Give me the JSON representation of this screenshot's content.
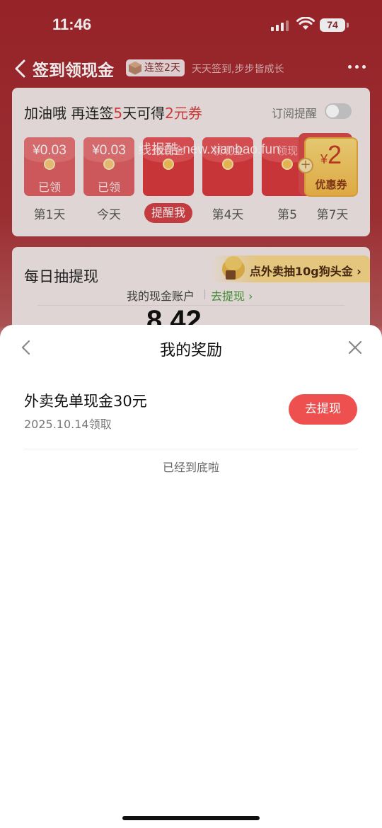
{
  "status_bar": {
    "time": "11:46",
    "battery": "74"
  },
  "nav": {
    "title": "签到领现金",
    "streak_badge": "连签2天",
    "slogan": "天天签到,步步皆成长"
  },
  "signin_card": {
    "headline_prefix": "加油哦  再连签",
    "headline_days": "5",
    "headline_mid": "天可得",
    "headline_reward": "2元券",
    "subscribe_label": "订阅提醒",
    "days": [
      {
        "amount": "¥0.03",
        "status": "已领",
        "label": "第1天"
      },
      {
        "amount": "¥0.03",
        "status": "已领",
        "label": "今天"
      },
      {
        "amount": "领现金",
        "status": "",
        "label": "提醒我"
      },
      {
        "amount": "领现金",
        "status": "",
        "label": "第4天"
      },
      {
        "amount": "领现",
        "status": "",
        "label": "第5"
      }
    ],
    "coupon": {
      "currency": "¥",
      "value": "2",
      "label": "优惠券"
    },
    "day7_label": "第7天"
  },
  "watermark": "线报酷-new.xianbao.fun",
  "draw_card": {
    "title": "每日抽提现",
    "promo": "点外卖抽10g狗头金 ›",
    "account_label": "我的现金账户",
    "withdraw_link": "去提现 ›",
    "balance": "8.42"
  },
  "sheet": {
    "title": "我的奖励",
    "reward_name": "外卖免单现金30元",
    "reward_date": "2025.10.14领取",
    "withdraw_button": "去提现",
    "end_text": "已经到底啦"
  },
  "colors": {
    "accent": "#ee5050",
    "header_bg": "#a2272c",
    "link_green": "#4a9a3a"
  }
}
